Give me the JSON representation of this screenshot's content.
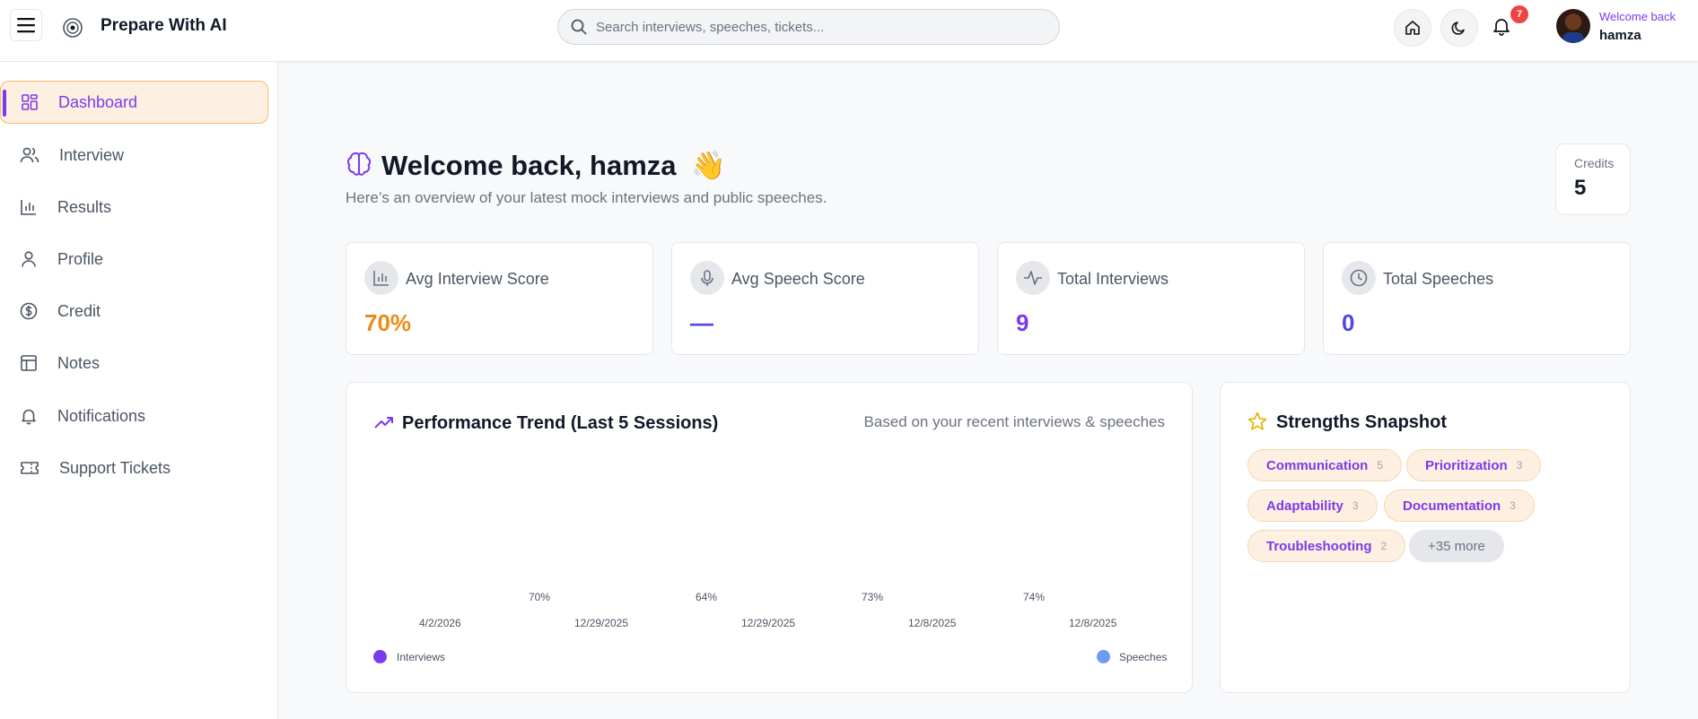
{
  "header": {
    "app_title": "Prepare With AI",
    "search_placeholder": "Search interviews, speeches, tickets...",
    "notification_count": "7",
    "welcome_label": "Welcome back",
    "user_name": "hamza"
  },
  "sidebar": {
    "items": [
      {
        "label": "Dashboard",
        "icon": "dashboard-icon",
        "active": true
      },
      {
        "label": "Interview",
        "icon": "users-icon"
      },
      {
        "label": "Results",
        "icon": "bar-chart-icon"
      },
      {
        "label": "Profile",
        "icon": "user-icon"
      },
      {
        "label": "Credit",
        "icon": "dollar-circle-icon"
      },
      {
        "label": "Notes",
        "icon": "table-icon"
      },
      {
        "label": "Notifications",
        "icon": "bell-icon"
      },
      {
        "label": "Support Tickets",
        "icon": "ticket-icon"
      }
    ]
  },
  "main": {
    "greeting": "Welcome back, hamza",
    "wave": "👋",
    "subtitle": "Here’s an overview of your latest mock interviews and public speeches.",
    "credits_label": "Credits",
    "credits_value": "5"
  },
  "stats": [
    {
      "label": "Avg Interview Score",
      "value": "70%",
      "color": "#ea8c1a",
      "icon": "bar-chart-icon"
    },
    {
      "label": "Avg Speech Score",
      "value": "—",
      "color": "#4f46e5",
      "icon": "microphone-icon"
    },
    {
      "label": "Total Interviews",
      "value": "9",
      "color": "#7c3aed",
      "icon": "activity-icon"
    },
    {
      "label": "Total Speeches",
      "value": "0",
      "color": "#4f46e5",
      "icon": "clock-icon"
    }
  ],
  "performance": {
    "title": "Performance Trend (Last 5 Sessions)",
    "note": "Based on your recent interviews & speeches",
    "value_labels": [
      "70%",
      "64%",
      "73%",
      "74%"
    ],
    "dates": [
      "4/2/2026",
      "12/29/2025",
      "12/29/2025",
      "12/8/2025",
      "12/8/2025"
    ],
    "legend": [
      {
        "name": "Interviews",
        "color": "#7c3aed"
      },
      {
        "name": "Speeches",
        "color": "#6d9bf1"
      }
    ]
  },
  "strengths": {
    "title": "Strengths Snapshot",
    "tags": [
      {
        "label": "Communication",
        "count": "5"
      },
      {
        "label": "Prioritization",
        "count": "3"
      },
      {
        "label": "Adaptability",
        "count": "3"
      },
      {
        "label": "Documentation",
        "count": "3"
      },
      {
        "label": "Troubleshooting",
        "count": "2"
      }
    ],
    "more": "+35 more"
  }
}
